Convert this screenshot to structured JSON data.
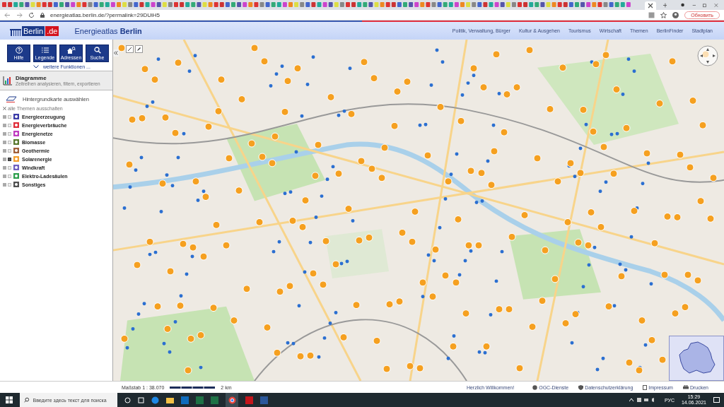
{
  "browser": {
    "url": "energieatlas.berlin.de/?permalink=29DUiH5",
    "update_button": "Обновить"
  },
  "header": {
    "logo_main": "Berlin",
    "logo_suffix": ".de",
    "title": "Energieatlas **Berlin**",
    "nav": [
      "Politik, Verwaltung, Bürger",
      "Kultur & Ausgehen",
      "Tourismus",
      "Wirtschaft",
      "Themen",
      "BerlinFinder",
      "Stadtplan"
    ]
  },
  "toolbar": {
    "buttons": [
      {
        "label": "Hilfe",
        "kind": "help"
      },
      {
        "label": "Legende",
        "kind": "list"
      },
      {
        "label": "Adressen",
        "kind": "house"
      },
      {
        "label": "Suche",
        "kind": "search"
      }
    ],
    "more": "weitere Funktionen ..."
  },
  "diagram": {
    "title": "Diagramme",
    "subtitle": "Zeitreihen analysieren, filtern, exportieren"
  },
  "basemap": "Hintergrundkarte auswählen",
  "themes_off": "alle Themen ausschalten",
  "themes": [
    {
      "label": "Energieerzeugung",
      "checked": false,
      "color": "#3b3ba8"
    },
    {
      "label": "Energieverbräuche",
      "checked": false,
      "color": "#e0303c"
    },
    {
      "label": "Energienetze",
      "checked": false,
      "color": "#c03cc0"
    },
    {
      "label": "Biomasse",
      "checked": false,
      "color": "#5a7a30"
    },
    {
      "label": "Geothermie",
      "checked": false,
      "color": "#a0603a"
    },
    {
      "label": "Solarenergie",
      "checked": true,
      "color": "#f5a030"
    },
    {
      "label": "Windkraft",
      "checked": false,
      "color": "#7060c0"
    },
    {
      "label": "Elektro-Ladesäulen",
      "checked": false,
      "color": "#30a050"
    },
    {
      "label": "Sonstiges",
      "checked": false,
      "color": "#505050"
    }
  ],
  "footer": {
    "scale": "Maßstab 1 : 38.070",
    "scale_unit": "2 km",
    "welcome": "Herzlich Willkommen!",
    "links": [
      {
        "label": "OGC-Dienste",
        "kind": "globe"
      },
      {
        "label": "Datenschutzerklärung",
        "kind": "shield"
      },
      {
        "label": "Impressum",
        "kind": "page"
      },
      {
        "label": "Drucken",
        "kind": "printer"
      }
    ]
  },
  "taskbar": {
    "search_placeholder": "Введите здесь текст для поиска",
    "language": "РУС",
    "time": "15:29",
    "date": "14.06.2021"
  }
}
